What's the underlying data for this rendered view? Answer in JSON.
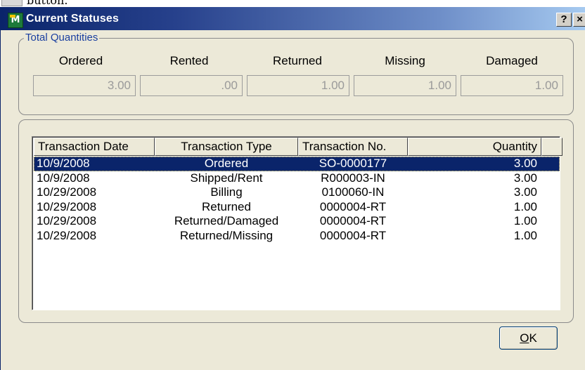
{
  "document": {
    "partial_text": "button."
  },
  "window": {
    "title": "Current Statuses",
    "help_label": "?",
    "close_label": "×"
  },
  "totals": {
    "legend": "Total Quantities",
    "fields": [
      {
        "label": "Ordered",
        "value": "3.00"
      },
      {
        "label": "Rented",
        "value": ".00"
      },
      {
        "label": "Returned",
        "value": "1.00"
      },
      {
        "label": "Missing",
        "value": "1.00"
      },
      {
        "label": "Damaged",
        "value": "1.00"
      }
    ]
  },
  "transactions": {
    "columns": [
      "Transaction Date",
      "Transaction Type",
      "Transaction No.",
      "Quantity"
    ],
    "rows": [
      {
        "date": "10/9/2008",
        "type": "Ordered",
        "no": "SO-0000177",
        "qty": "3.00",
        "selected": true
      },
      {
        "date": "10/9/2008",
        "type": "Shipped/Rent",
        "no": "R000003-IN",
        "qty": "3.00"
      },
      {
        "date": "10/29/2008",
        "type": "Billing",
        "no": "0100060-IN",
        "qty": "3.00"
      },
      {
        "date": "10/29/2008",
        "type": "Returned",
        "no": "0000004-RT",
        "qty": "1.00"
      },
      {
        "date": "10/29/2008",
        "type": "Returned/Damaged",
        "no": "0000004-RT",
        "qty": "1.00"
      },
      {
        "date": "10/29/2008",
        "type": "Returned/Missing",
        "no": "0000004-RT",
        "qty": "1.00"
      }
    ]
  },
  "buttons": {
    "ok_mnemonic": "O",
    "ok_rest": "K"
  },
  "colors": {
    "title_gradient_start": "#0a246a",
    "selection": "#0a246a",
    "legend_text": "#1a3fa0"
  }
}
